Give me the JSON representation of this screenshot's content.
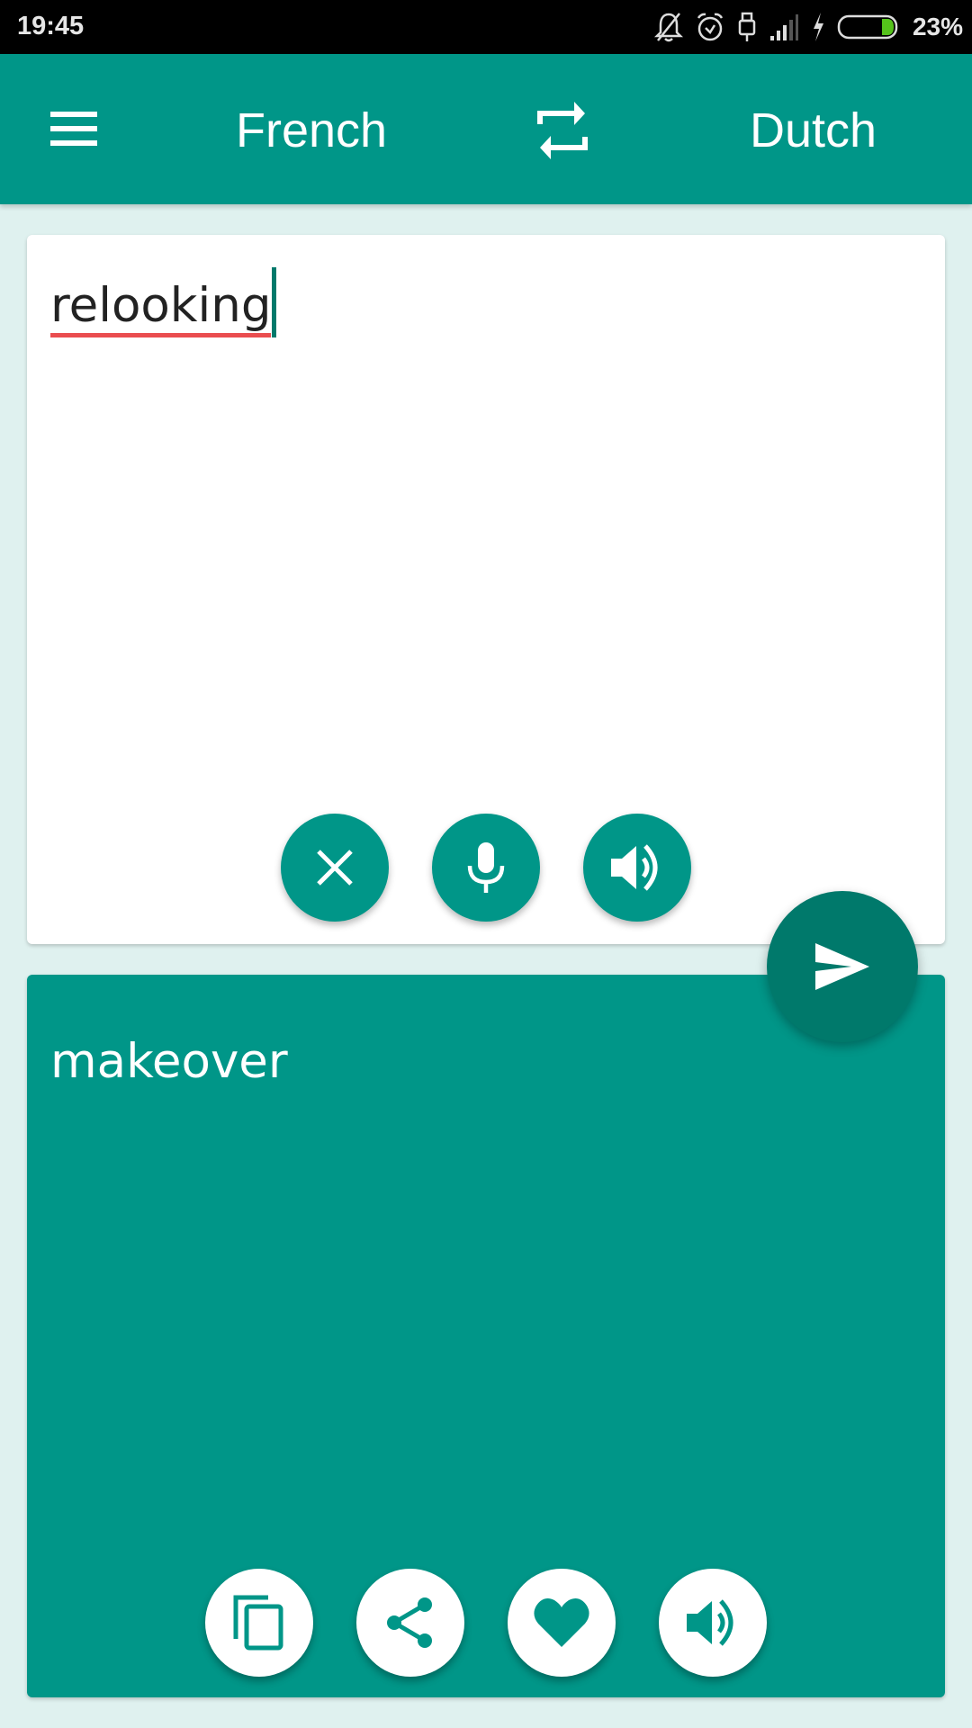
{
  "status_bar": {
    "time": "19:45",
    "battery_percent": "23%",
    "battery_level": 0.23,
    "icons": [
      "notifications-off-icon",
      "alarm-icon",
      "usb-icon",
      "signal-icon",
      "charging-icon",
      "battery-icon"
    ]
  },
  "app_bar": {
    "menu_icon": "menu-icon",
    "source_language": "French",
    "swap_icon": "swap-languages-icon",
    "target_language": "Dutch"
  },
  "input_card": {
    "text": "relooking",
    "actions": [
      {
        "name": "clear",
        "icon": "close-icon"
      },
      {
        "name": "voice-input",
        "icon": "microphone-icon"
      },
      {
        "name": "speak-input",
        "icon": "speaker-icon"
      }
    ]
  },
  "translate_button": {
    "icon": "send-icon"
  },
  "output_card": {
    "text": "makeover",
    "actions": [
      {
        "name": "copy",
        "icon": "copy-icon"
      },
      {
        "name": "share",
        "icon": "share-icon"
      },
      {
        "name": "favorite",
        "icon": "heart-icon"
      },
      {
        "name": "speak-output",
        "icon": "speaker-icon"
      }
    ]
  },
  "colors": {
    "primary": "#009688",
    "primary_dark": "#00796b",
    "background": "#dff1ef",
    "spellcheck_underline": "#ea4d4f"
  }
}
